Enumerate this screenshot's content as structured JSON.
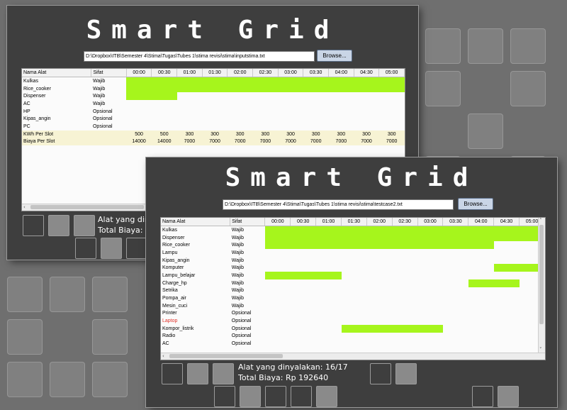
{
  "slots": [
    "00:00",
    "00:30",
    "01:00",
    "01:30",
    "02:00",
    "02:30",
    "03:00",
    "03:30",
    "04:00",
    "04:30",
    "05:00"
  ],
  "window1": {
    "title": "Smart Grid",
    "path": "D:\\Dropbox\\ITB\\Semester 4\\Stima\\Tugas\\Tubes 1\\stima revisi\\stima\\inputstima.txt",
    "browse_label": "Browse...",
    "headers": {
      "name": "Nama Alat",
      "sifat": "Sifat"
    },
    "rows": [
      {
        "name": "Kulkas",
        "sifat": "Wajib",
        "on": [
          0,
          1,
          2,
          3,
          4,
          5,
          6,
          7,
          8,
          9,
          10
        ]
      },
      {
        "name": "Rice_cooker",
        "sifat": "Wajib",
        "on": [
          0,
          1,
          2,
          3,
          4,
          5,
          6,
          7,
          8,
          9,
          10
        ]
      },
      {
        "name": "Dispenser",
        "sifat": "Wajib",
        "on": [
          0,
          1
        ]
      },
      {
        "name": "AC",
        "sifat": "Wajib",
        "on": []
      },
      {
        "name": "HP",
        "sifat": "Opsional",
        "on": []
      },
      {
        "name": "Kipas_angin",
        "sifat": "Opsional",
        "on": []
      },
      {
        "name": "PC",
        "sifat": "Opsional",
        "on": []
      }
    ],
    "info_rows": [
      {
        "name": "KWh Per Slot",
        "values": [
          "500",
          "500",
          "300",
          "300",
          "300",
          "300",
          "300",
          "300",
          "300",
          "300",
          "300"
        ]
      },
      {
        "name": "Biaya Per Slot",
        "values": [
          "14000",
          "14000",
          "7000",
          "7000",
          "7000",
          "7000",
          "7000",
          "7000",
          "7000",
          "7000",
          "7000"
        ]
      }
    ],
    "status_devices": "Alat yang dinyalakan:",
    "status_cost": "Total Biaya:"
  },
  "window2": {
    "title": "Smart Grid",
    "path": "D:\\Dropbox\\ITB\\Semester 4\\Stima\\Tugas\\Tubes 1\\stima revisi\\stima\\testcase2.txt",
    "browse_label": "Browse...",
    "headers": {
      "name": "Nama Alat",
      "sifat": "Sifat"
    },
    "rows": [
      {
        "name": "Kulkas",
        "sifat": "Wajib",
        "on": [
          0,
          1,
          2,
          3,
          4,
          5,
          6,
          7,
          8,
          9,
          10
        ]
      },
      {
        "name": "Dispenser",
        "sifat": "Wajib",
        "on": [
          0,
          1,
          2,
          3,
          4,
          5,
          6,
          7,
          8,
          9,
          10
        ]
      },
      {
        "name": "Rice_cooker",
        "sifat": "Wajib",
        "on": [
          0,
          1,
          2,
          3,
          4,
          5,
          6,
          7,
          8
        ]
      },
      {
        "name": "Lampu",
        "sifat": "Wajib",
        "on": []
      },
      {
        "name": "Kipas_angin",
        "sifat": "Wajib",
        "on": []
      },
      {
        "name": "Komputer",
        "sifat": "Wajib",
        "on": [
          9,
          10
        ]
      },
      {
        "name": "Lampu_belajar",
        "sifat": "Wajib",
        "on": [
          0,
          1,
          2
        ]
      },
      {
        "name": "Charge_hp",
        "sifat": "Wajib",
        "on": [
          8,
          9
        ]
      },
      {
        "name": "Setrika",
        "sifat": "Wajib",
        "on": []
      },
      {
        "name": "Pompa_air",
        "sifat": "Wajib",
        "on": []
      },
      {
        "name": "Mesin_cuci",
        "sifat": "Wajib",
        "on": []
      },
      {
        "name": "Printer",
        "sifat": "Opsional",
        "on": []
      },
      {
        "name": "Laptop",
        "sifat": "Opsional",
        "on": [],
        "highlight": "#e0332b"
      },
      {
        "name": "Kompor_listrik",
        "sifat": "Opsional",
        "on": [
          3,
          4,
          5,
          6
        ]
      },
      {
        "name": "Radio",
        "sifat": "Opsional",
        "on": []
      },
      {
        "name": "AC",
        "sifat": "Opsional",
        "on": []
      }
    ],
    "status_devices": "Alat yang dinyalakan: 16/17",
    "status_cost": "Total Biaya: Rp 192640"
  },
  "colors": {
    "bar": "#a6f51c",
    "info_row": "#f7f3d4",
    "window_bg": "#3e3e3e",
    "highlight_text": "#e0332b"
  }
}
